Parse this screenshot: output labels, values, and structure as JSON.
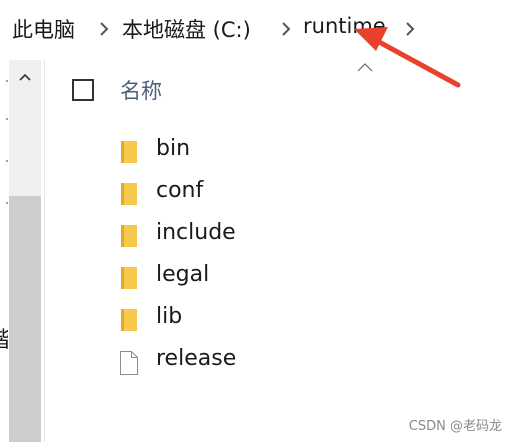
{
  "breadcrumb": {
    "items": [
      {
        "label": "此电脑"
      },
      {
        "label": "本地磁盘 (C:)"
      },
      {
        "label": "runtime"
      }
    ]
  },
  "file_list": {
    "column_header": {
      "name_label": "名称"
    },
    "items": [
      {
        "name": "bin",
        "type": "folder",
        "icon": "folder-icon"
      },
      {
        "name": "conf",
        "type": "folder",
        "icon": "folder-icon"
      },
      {
        "name": "include",
        "type": "folder",
        "icon": "folder-icon"
      },
      {
        "name": "legal",
        "type": "folder",
        "icon": "folder-icon"
      },
      {
        "name": "lib",
        "type": "folder",
        "icon": "folder-icon"
      },
      {
        "name": "release",
        "type": "file",
        "icon": "file-icon"
      }
    ]
  },
  "nav_pane": {
    "partial_label": "谐"
  },
  "annotation": {
    "color": "#e8412c",
    "icon": "red-arrow"
  },
  "colors": {
    "folder": "#f6c94d",
    "folder_dark": "#e3a92a",
    "header_text": "#4c607a",
    "scroll_track": "#f0f0f0",
    "scroll_thumb": "#cdcdcd"
  },
  "watermark": {
    "text": "CSDN @老码龙"
  }
}
